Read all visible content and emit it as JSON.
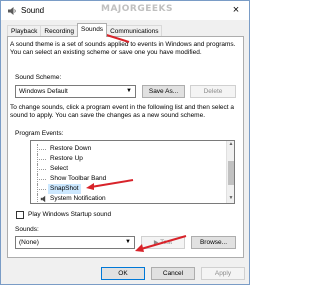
{
  "window": {
    "title": "Sound",
    "watermark": "MAJORGEEKS",
    "close_label": "×"
  },
  "tabs": [
    {
      "label": "Playback"
    },
    {
      "label": "Recording"
    },
    {
      "label": "Sounds",
      "active": true
    },
    {
      "label": "Communications"
    }
  ],
  "sounds_tab": {
    "description": "A sound theme is a set of sounds applied to events in Windows and programs. You can select an existing scheme or save one you have modified.",
    "scheme_label": "Sound Scheme:",
    "scheme_value": "Windows Default",
    "save_as_label": "Save As...",
    "delete_label": "Delete",
    "events_description": "To change sounds, click a program event in the following list and then select a sound to apply. You can save the changes as a new sound scheme.",
    "events_label": "Program Events:",
    "events": [
      {
        "label": "Restore Down",
        "icon": false,
        "selected": false
      },
      {
        "label": "Restore Up",
        "icon": false,
        "selected": false
      },
      {
        "label": "Select",
        "icon": false,
        "selected": false
      },
      {
        "label": "Show Toolbar Band",
        "icon": false,
        "selected": false
      },
      {
        "label": "SnapShot",
        "icon": false,
        "selected": true
      },
      {
        "label": "System Notification",
        "icon": true,
        "selected": false
      }
    ],
    "startup_checkbox_label": "Play Windows Startup sound",
    "startup_checked": false,
    "sounds_label": "Sounds:",
    "sound_value": "(None)",
    "test_label": "Test",
    "browse_label": "Browse..."
  },
  "footer": {
    "ok_label": "OK",
    "cancel_label": "Cancel",
    "apply_label": "Apply"
  },
  "colors": {
    "annotation_arrow": "#d8232a",
    "selection_highlight": "#cce8ff",
    "accent_border": "#0078d7"
  }
}
